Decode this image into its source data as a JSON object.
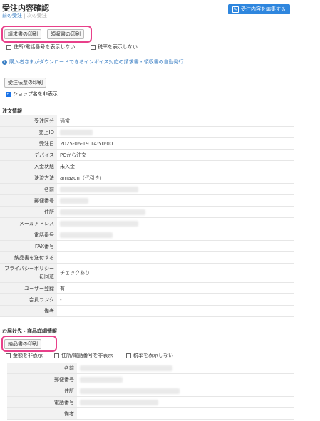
{
  "header": {
    "title": "受注内容確認",
    "prev_link": "前の受注",
    "separator": "|",
    "next_link": "次の受注",
    "edit_button": "受注内容を編集する"
  },
  "print_buttons": {
    "invoice": "請求書の印刷",
    "receipt": "領収書の印刷"
  },
  "print_options": {
    "hide_address": "住所/電話番号を表示しない",
    "hide_tax": "税率を表示しない"
  },
  "info_link": "購入者さまがダウンロードできるインボイス対応の請求書・領収書の自動発行",
  "order_slip_button": "受注伝票の印刷",
  "hide_shop_name": "ショップ名を非表示",
  "order_section": {
    "title": "注文情報",
    "rows": [
      {
        "label": "受注区分",
        "value": "通常"
      },
      {
        "label": "売上ID",
        "value": ""
      },
      {
        "label": "受注日",
        "value": "2025-06-19 14:50:00"
      },
      {
        "label": "デバイス",
        "value": "PCから注文"
      },
      {
        "label": "入金状態",
        "value": "未入金"
      },
      {
        "label": "決済方法",
        "value": "amazon（代引き）"
      },
      {
        "label": "名前",
        "value": ""
      },
      {
        "label": "郵便番号",
        "value": ""
      },
      {
        "label": "住所",
        "value": ""
      },
      {
        "label": "メールアドレス",
        "value": ""
      },
      {
        "label": "電話番号",
        "value": ""
      },
      {
        "label": "FAX番号",
        "value": ""
      },
      {
        "label": "納品書を送付する",
        "value": ""
      },
      {
        "label": "プライバシーポリシーに同意",
        "value": "チェックあり"
      },
      {
        "label": "ユーザー登録",
        "value": "有"
      },
      {
        "label": "会員ランク",
        "value": "-"
      },
      {
        "label": "備考",
        "value": ""
      }
    ]
  },
  "shipping_section": {
    "title": "お届け先・商品詳細情報",
    "delivery_button": "納品書の印刷",
    "options": {
      "hide_amount": "金額を非表示",
      "hide_address": "住所/電話番号を非表示",
      "hide_tax": "税率を表示しない"
    },
    "rows": [
      {
        "label": "名前",
        "value": ""
      },
      {
        "label": "郵便番号",
        "value": ""
      },
      {
        "label": "住所",
        "value": ""
      },
      {
        "label": "電話番号",
        "value": ""
      },
      {
        "label": "備考",
        "value": ""
      }
    ]
  }
}
